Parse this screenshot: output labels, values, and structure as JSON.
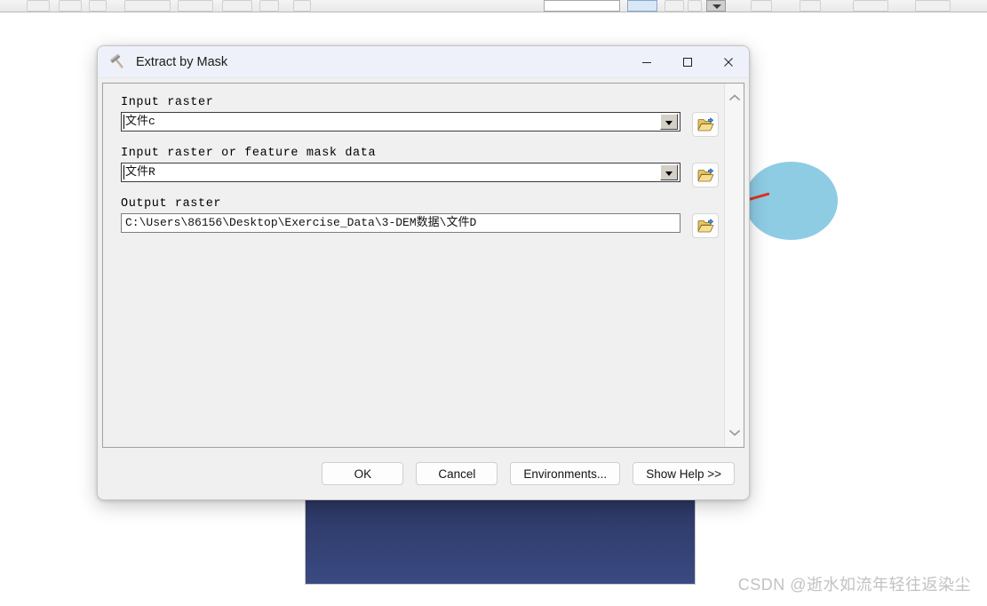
{
  "window": {
    "title": "Extract by Mask",
    "icon": "hammer-icon",
    "minimize_label": "Minimize",
    "maximize_label": "Maximize",
    "close_label": "Close"
  },
  "form": {
    "fields": [
      {
        "label": "Input raster",
        "value": "文件c",
        "control": "combobox",
        "browse_icon": "open-folder-add-icon"
      },
      {
        "label": "Input raster or feature mask data",
        "value": "文件R",
        "control": "combobox",
        "browse_icon": "open-folder-add-icon"
      },
      {
        "label": "Output raster",
        "value": "C:\\Users\\86156\\Desktop\\Exercise_Data\\3-DEM数据\\文件D",
        "control": "textbox",
        "browse_icon": "open-folder-add-icon"
      }
    ]
  },
  "scrollbar": {
    "up_icon": "chevron-up-icon",
    "down_icon": "chevron-down-icon"
  },
  "footer": {
    "ok": "OK",
    "cancel": "Cancel",
    "environments": "Environments...",
    "show_help": "Show Help >>"
  },
  "watermark": {
    "text": "CSDN @逝水如流年轻往返染尘"
  },
  "colors": {
    "titlebar": "#eef1f9",
    "dialog_bg": "#f0f0f0",
    "map_polygon": "#8ecce4",
    "map_line": "#dd3322",
    "navy_panel": "#3a4a82",
    "watermark": "#c2c2c2"
  }
}
